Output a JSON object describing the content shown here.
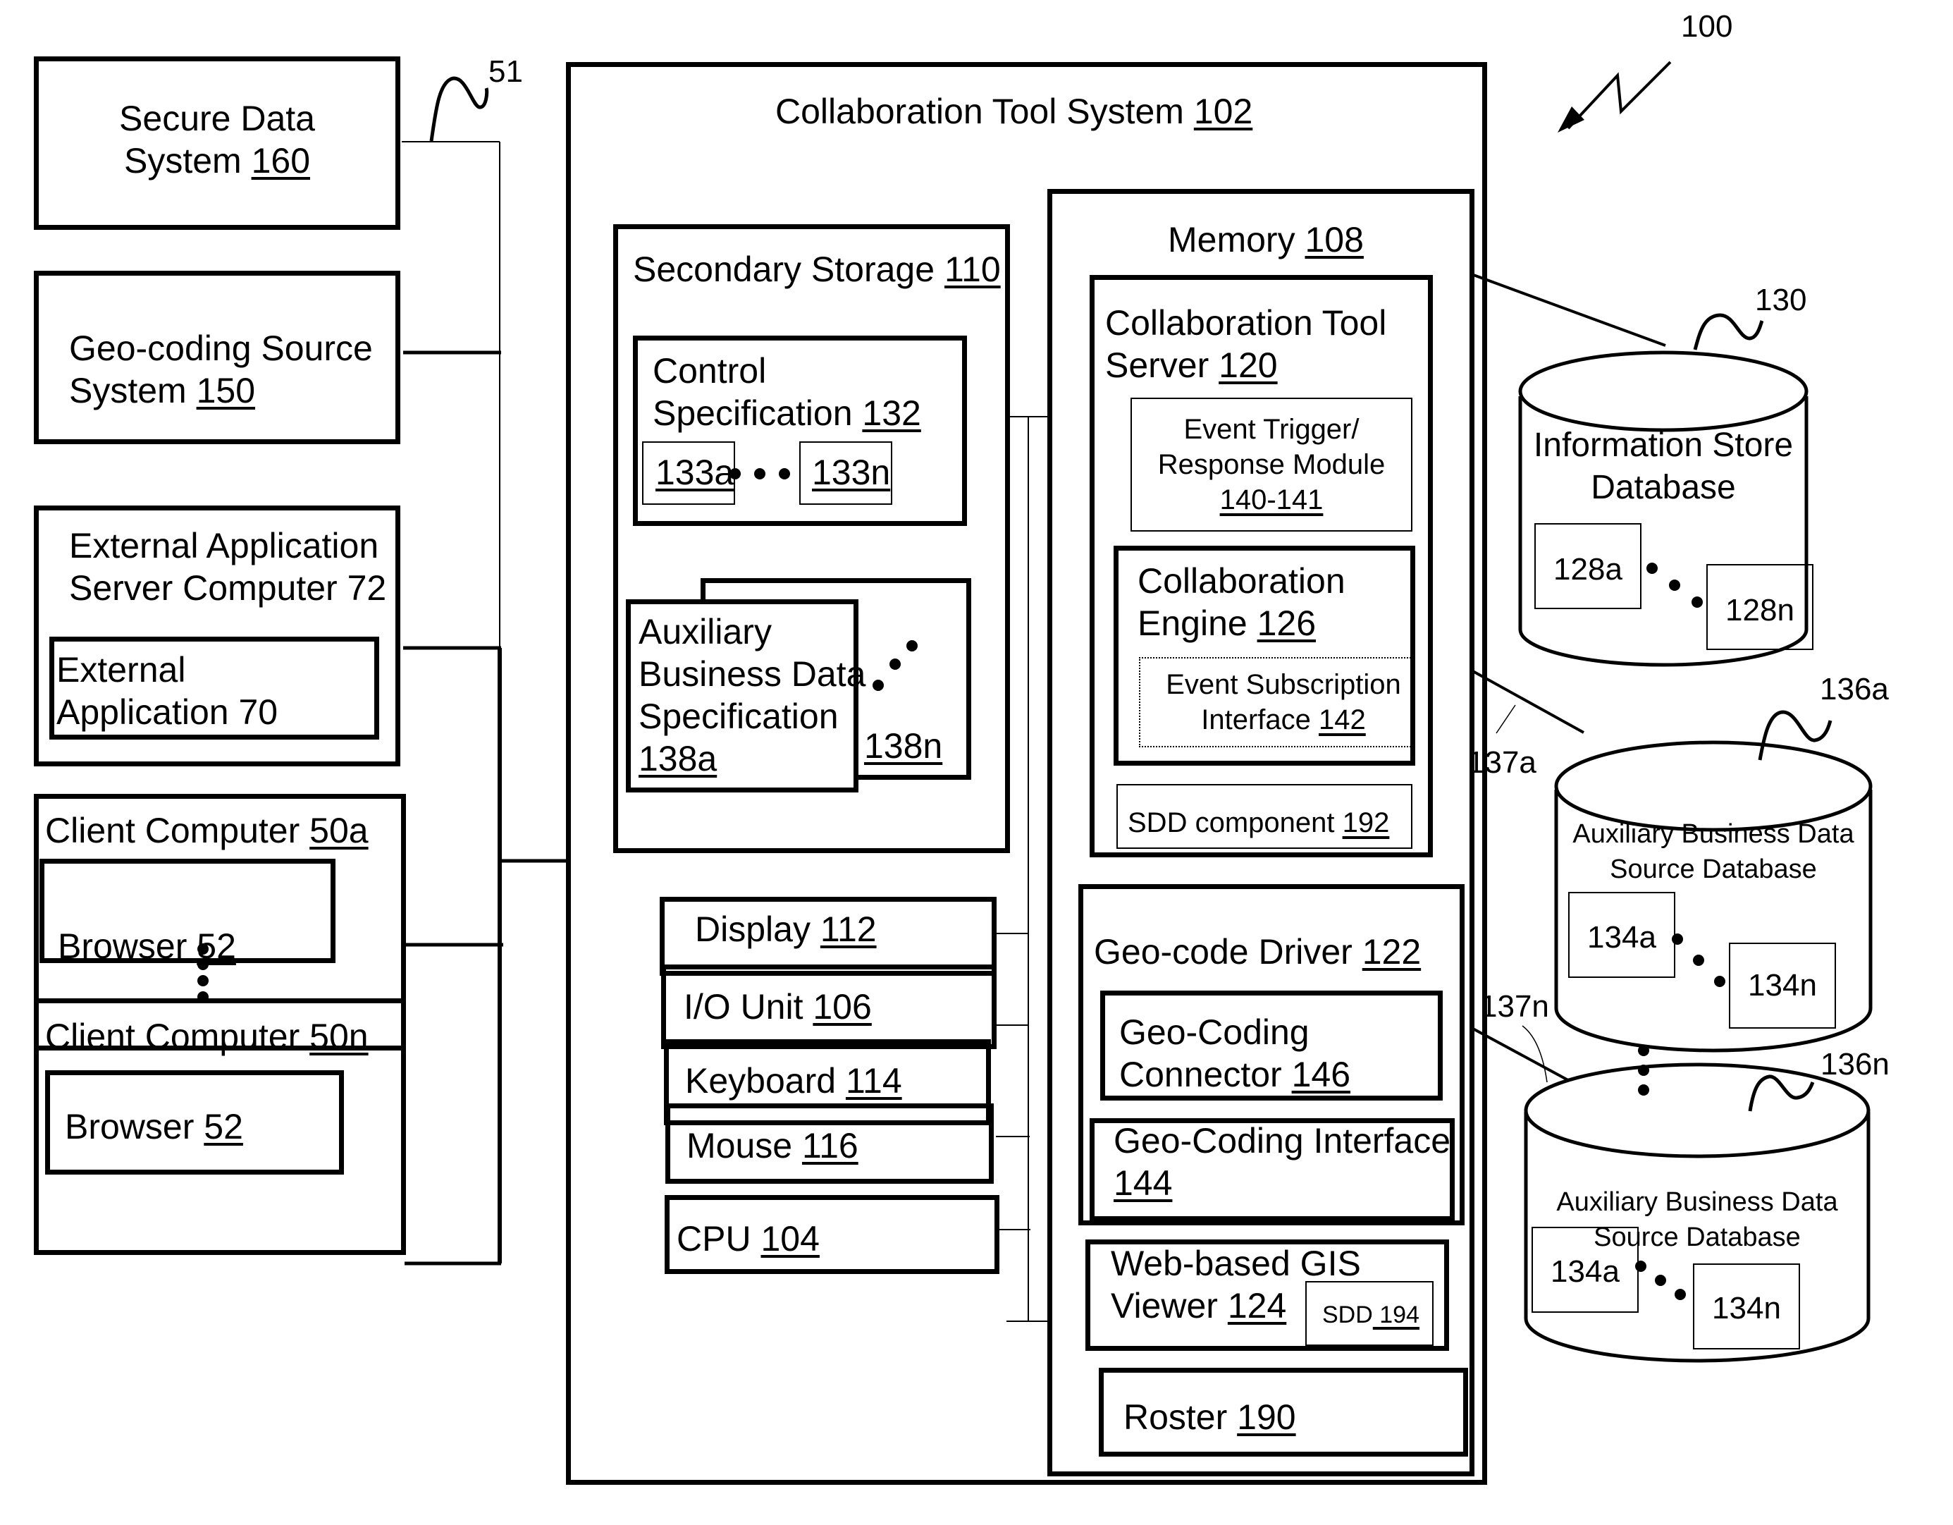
{
  "figure": {
    "ref": "100",
    "network_ref": "51",
    "left_systems": {
      "secure_data": {
        "line1": "Secure Data",
        "line2": "System ",
        "num": "160"
      },
      "geo_coding_source": {
        "line1": "Geo-coding Source",
        "line2": "System ",
        "num": "150"
      },
      "external_app_server": {
        "line1": "External Application",
        "line2": "Server Computer 72",
        "inner": {
          "line1": "External",
          "line2": "Application 70"
        }
      },
      "client_a": {
        "title": "Client Computer ",
        "num": "50a",
        "browser": "Browser ",
        "browser_num": "52"
      },
      "client_n": {
        "title": "Client Computer ",
        "num": "50n",
        "browser": "Browser ",
        "browser_num": "52"
      }
    },
    "main_system": {
      "title": "Collaboration Tool System ",
      "num": "102",
      "secondary_storage": {
        "title": "Secondary Storage ",
        "num": "110",
        "control_spec": {
          "line1": "Control",
          "line2": "Specification ",
          "num": "132",
          "item_a": "133a",
          "item_n": "133n"
        },
        "aux_spec": {
          "line1": "Auxiliary",
          "line2": "Business Data",
          "line3": "Specification",
          "num": "138a",
          "num_n": "138n"
        }
      },
      "devices": [
        {
          "label": "Display ",
          "num": "112"
        },
        {
          "label": "I/O Unit ",
          "num": "106"
        },
        {
          "label": "Keyboard  ",
          "num": "114"
        },
        {
          "label": "Mouse  ",
          "num": "116"
        },
        {
          "label": "CPU   ",
          "num": "104"
        }
      ],
      "memory": {
        "title": "Memory  ",
        "num": "108",
        "cts": {
          "line1": "Collaboration Tool",
          "line2": "Server ",
          "num": "120",
          "event_trigger": {
            "line1": "Event Trigger/",
            "line2": "Response Module",
            "num": "140-141"
          },
          "engine": {
            "line1": "Collaboration",
            "line2": "Engine  ",
            "num": "126",
            "subscription": {
              "line1": "Event Subscription",
              "line2": "Interface ",
              "num": "142"
            }
          },
          "sdd": {
            "label": "SDD component ",
            "num": "192"
          }
        },
        "geo_driver": {
          "title": "Geo-code Driver ",
          "num": "122",
          "connector": {
            "line1": "Geo-Coding",
            "line2": "Connector ",
            "num": "146"
          },
          "interface": {
            "line1": "Geo-Coding Interface",
            "num": "144"
          }
        },
        "gis_viewer": {
          "line1": "Web-based GIS",
          "line2": "Viewer ",
          "num": "124",
          "sdd_label": "SDD",
          "sdd_num": " 194"
        },
        "roster": {
          "label": "Roster ",
          "num": "190"
        }
      }
    },
    "databases": {
      "info_store": {
        "ref": "130",
        "line1": "Information Store",
        "line2": "Database",
        "item_a": "128a",
        "item_n": "128n"
      },
      "aux_a": {
        "ref": "136a",
        "line1": "Auxiliary Business Data",
        "line2": "Source Database",
        "item_a": "134a",
        "item_n": "134n",
        "link": "137a"
      },
      "aux_n": {
        "ref": "136n",
        "line1": "Auxiliary Business Data",
        "line2": "Source Database",
        "item_a": "134a",
        "item_n": "134n",
        "link": "137n"
      }
    }
  }
}
